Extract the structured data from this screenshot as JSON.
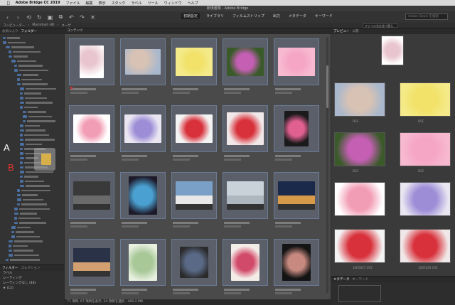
{
  "menubar": {
    "apple": "",
    "app": "Adobe Bridge CC 2019",
    "items": [
      "ファイル",
      "編集",
      "表示",
      "スタック",
      "ラベル",
      "ツール",
      "ウィンドウ",
      "ヘルプ"
    ]
  },
  "titlebar": {
    "title": "新規書類 - Adobe Bridge"
  },
  "toolbar": {
    "icons": [
      "back-icon",
      "forward-icon",
      "history-icon",
      "refresh-icon",
      "camera-icon",
      "batch-icon",
      "rotate-left-icon",
      "rotate-right-icon",
      "delete-icon"
    ],
    "workspaces": [
      "初期設定",
      "ライブラリ",
      "フィルムストリップ",
      "出力",
      "メタデータ",
      "キーワード"
    ],
    "active_workspace": 0,
    "search_placeholder": "Adobe Stock を検索"
  },
  "pathbar": {
    "crumbs": [
      "コンピューター",
      "Macintosh HD",
      "ユーザ"
    ],
    "sort_label": "ファイル名を並べ替え"
  },
  "left_panel": {
    "tabs": [
      "お気に入り",
      "フォルダー"
    ],
    "active_tab": 1,
    "filter_tabs": [
      "フィルター",
      "コレクション"
    ],
    "filter_rows": [
      "ラベル",
      "レーティング",
      "レーティングなし (48)",
      "★ (12)"
    ]
  },
  "overlay": {
    "label_a": "A",
    "label_b": "B"
  },
  "center": {
    "header": "コンテンツ",
    "footer": "71 項目, 67 項目を表示, 24 項目を選択 - 400.2 MB",
    "thumbnails": [
      {
        "kind": "blossom",
        "color": "#e9c6cf",
        "frame": "#ffffff",
        "w": 34,
        "h": 46
      },
      {
        "kind": "blossom",
        "color": "#d8c2b4",
        "frame": "#a9b8cc",
        "w": 50,
        "h": 36
      },
      {
        "kind": "flower",
        "color": "#f2e26a",
        "frame": "#f4ea8a",
        "w": 52,
        "h": 40
      },
      {
        "kind": "flower",
        "color": "#c45fb3",
        "frame": "#3a5a2a",
        "w": 52,
        "h": 40
      },
      {
        "kind": "flower",
        "color": "#f5a6c4",
        "frame": "#f7b9d0",
        "w": 52,
        "h": 40
      },
      {
        "kind": "flower",
        "color": "#f29db6",
        "frame": "#ffffff",
        "w": 52,
        "h": 40
      },
      {
        "kind": "flower",
        "color": "#9c8dd6",
        "frame": "#e9e5f1",
        "w": 52,
        "h": 40
      },
      {
        "kind": "flower",
        "color": "#d8313b",
        "frame": "#f3f3f3",
        "w": 52,
        "h": 40
      },
      {
        "kind": "flower",
        "color": "#d8313b",
        "frame": "#f0e8e8",
        "w": 52,
        "h": 46
      },
      {
        "kind": "flower",
        "color": "#e06090",
        "frame": "#1a1a1a",
        "w": 34,
        "h": 50
      },
      {
        "kind": "street",
        "color": "#6a6a6a",
        "frame": "#3a3a3a",
        "w": 52,
        "h": 40
      },
      {
        "kind": "abstract",
        "color": "#4aa0d0",
        "frame": "#1e1a2a",
        "w": 40,
        "h": 54
      },
      {
        "kind": "building",
        "color": "#e8e8e8",
        "frame": "#7aa0c8",
        "w": 52,
        "h": 40
      },
      {
        "kind": "building",
        "color": "#aeb6c0",
        "frame": "#c9d1d9",
        "w": 52,
        "h": 40
      },
      {
        "kind": "building",
        "color": "#d69a48",
        "frame": "#1b2a4a",
        "w": 52,
        "h": 40
      },
      {
        "kind": "house",
        "color": "#d2a070",
        "frame": "#2a3248",
        "w": 52,
        "h": 40
      },
      {
        "kind": "arch",
        "color": "#a8c898",
        "frame": "#e8f0e0",
        "w": 40,
        "h": 52
      },
      {
        "kind": "still",
        "color": "#5a6a86",
        "frame": "#2a2a2a",
        "w": 40,
        "h": 44
      },
      {
        "kind": "flower",
        "color": "#d24a6a",
        "frame": "#f3ede8",
        "w": 40,
        "h": 52
      },
      {
        "kind": "flower",
        "color": "#c88a80",
        "frame": "#141414",
        "w": 40,
        "h": 52
      }
    ],
    "flag_index": 0
  },
  "right_panel": {
    "tabs": [
      "プレビュー",
      "公開"
    ],
    "meta_tabs": [
      "メタデータ",
      "キーワード"
    ],
    "preview_labels": [
      "DSC",
      "DSC",
      "DSC",
      "DSC",
      "10D5027.CR2",
      "10D5026.CR2"
    ]
  }
}
